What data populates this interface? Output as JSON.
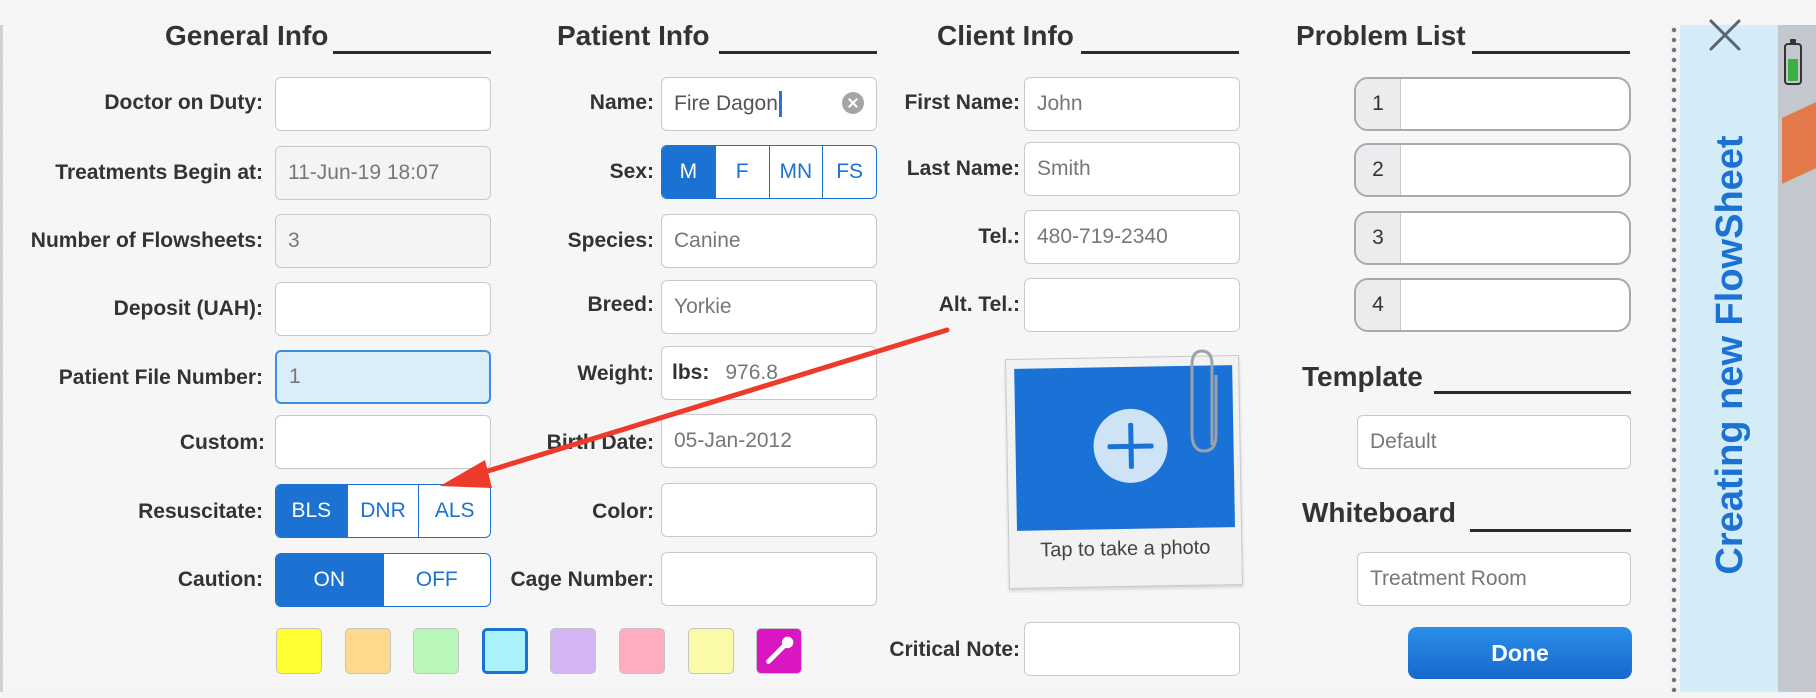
{
  "sections": {
    "general": "General Info",
    "patient": "Patient Info",
    "client": "Client Info",
    "problems": "Problem List",
    "template": "Template",
    "whiteboard": "Whiteboard"
  },
  "general": {
    "doctor_label": "Doctor on Duty:",
    "doctor_value": "",
    "treatments_label": "Treatments Begin at:",
    "treatments_value": "11-Jun-19 18:07",
    "flowsheets_label": "Number of Flowsheets:",
    "flowsheets_value": "3",
    "deposit_label": "Deposit (UAH):",
    "deposit_value": "",
    "file_label": "Patient File Number:",
    "file_value": "1",
    "custom_label": "Custom:",
    "custom_value": "",
    "resuscitate_label": "Resuscitate:",
    "resuscitate_options": [
      "BLS",
      "DNR",
      "ALS"
    ],
    "resuscitate_selected": "BLS",
    "caution_label": "Caution:",
    "caution_options": [
      "ON",
      "OFF"
    ],
    "caution_selected": "ON"
  },
  "patient": {
    "name_label": "Name:",
    "name_value": "Fire Dagon",
    "sex_label": "Sex:",
    "sex_options": [
      "M",
      "F",
      "MN",
      "FS"
    ],
    "sex_selected": "M",
    "species_label": "Species:",
    "species_value": "Canine",
    "breed_label": "Breed:",
    "breed_value": "Yorkie",
    "weight_label": "Weight:",
    "weight_unit": "lbs:",
    "weight_value": "976.8",
    "birth_label": "Birth Date:",
    "birth_value": "05-Jan-2012",
    "color_label": "Color:",
    "color_value": "",
    "cage_label": "Cage Number:",
    "cage_value": ""
  },
  "client": {
    "first_label": "First Name:",
    "first_value": "John",
    "last_label": "Last Name:",
    "last_value": "Smith",
    "tel_label": "Tel.:",
    "tel_value": "480-719-2340",
    "alt_label": "Alt. Tel.:",
    "alt_value": "",
    "photo_caption": "Tap to take a photo",
    "critical_label": "Critical Note:",
    "critical_value": ""
  },
  "problems": [
    "1",
    "2",
    "3",
    "4"
  ],
  "template_value": "Default",
  "whiteboard_value": "Treatment Room",
  "done_label": "Done",
  "sidebar_title": "Creating new FlowSheet",
  "colors": {
    "accent": "#1b72d3",
    "arrow": "#ee3a2a",
    "swatches": [
      "#ffff33",
      "#ffd98c",
      "#b9f7b9",
      "#a9f1fb",
      "#d4b6f5",
      "#ffadbe",
      "#fbfaa6",
      "#d916c1"
    ],
    "selected_swatch_index": 3
  }
}
